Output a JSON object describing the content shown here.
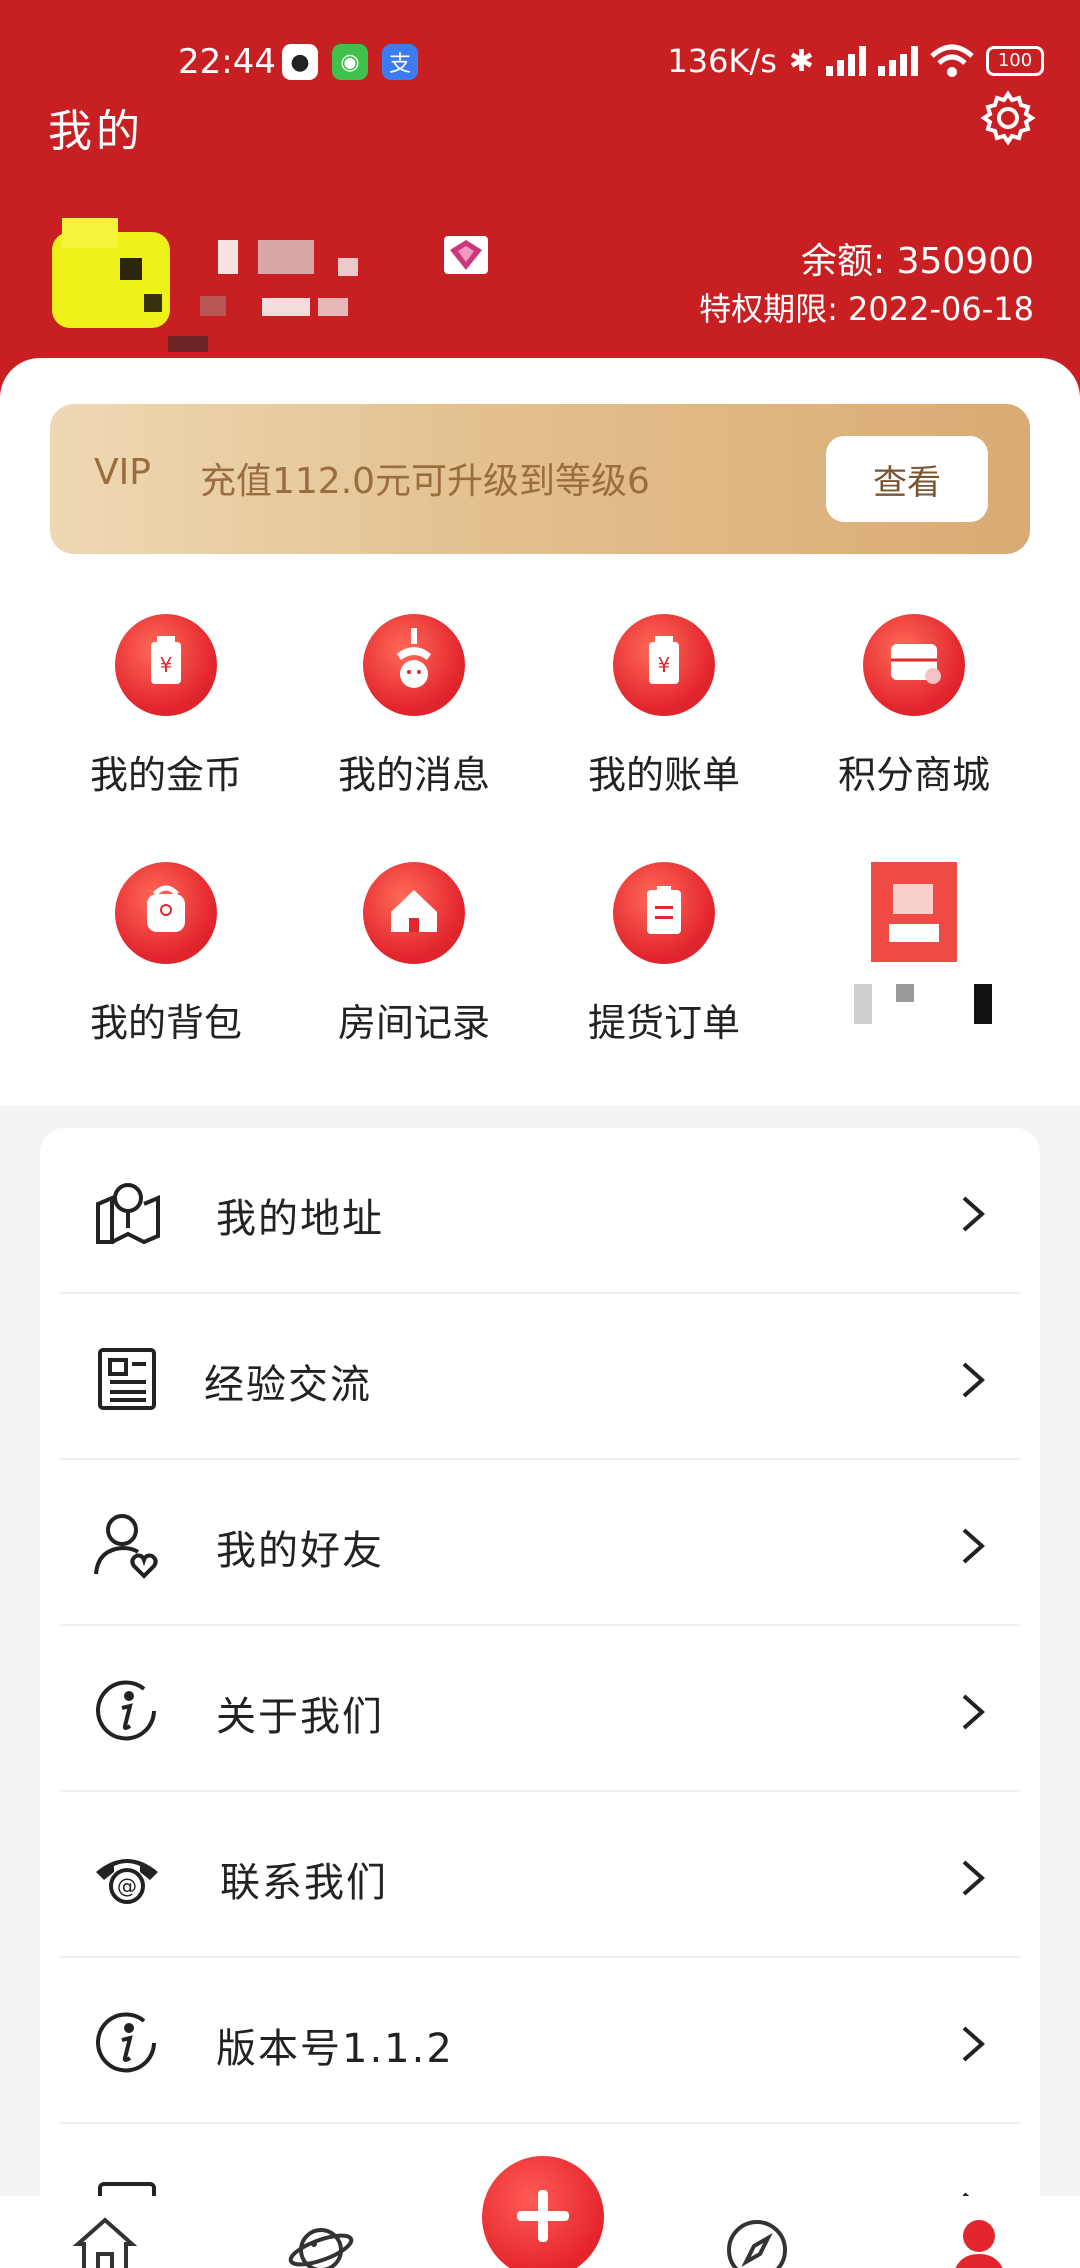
{
  "status_bar": {
    "time": "22:44",
    "net_speed": "136K/s",
    "battery": "100"
  },
  "header": {
    "title": "我的",
    "balance": "余额: 350900",
    "expiry": "特权期限: 2022-06-18"
  },
  "vip_banner": {
    "label": "VIP",
    "text": "充值112.0元可升级到等级6",
    "button": "查看"
  },
  "grid": [
    {
      "label": "我的金币",
      "icon": "coin-bag-icon"
    },
    {
      "label": "我的消息",
      "icon": "claw-machine-icon"
    },
    {
      "label": "我的账单",
      "icon": "bill-icon"
    },
    {
      "label": "积分商城",
      "icon": "store-icon"
    },
    {
      "label": "我的背包",
      "icon": "backpack-icon"
    },
    {
      "label": "房间记录",
      "icon": "house-icon"
    },
    {
      "label": "提货订单",
      "icon": "clipboard-icon"
    },
    {
      "label": "",
      "icon": "pixelated-icon"
    }
  ],
  "menu": [
    {
      "label": "我的地址",
      "icon": "map-pin-icon"
    },
    {
      "label": "经验交流",
      "icon": "news-icon"
    },
    {
      "label": "我的好友",
      "icon": "friend-icon"
    },
    {
      "label": "关于我们",
      "icon": "info-icon"
    },
    {
      "label": "联系我们",
      "icon": "phone-at-icon"
    },
    {
      "label": "版本号1.1.2",
      "icon": "info-icon"
    }
  ],
  "colors": {
    "header_red": "#c81f22",
    "icon_red": "#e3262e",
    "vip_gold": "#e3c08e"
  }
}
